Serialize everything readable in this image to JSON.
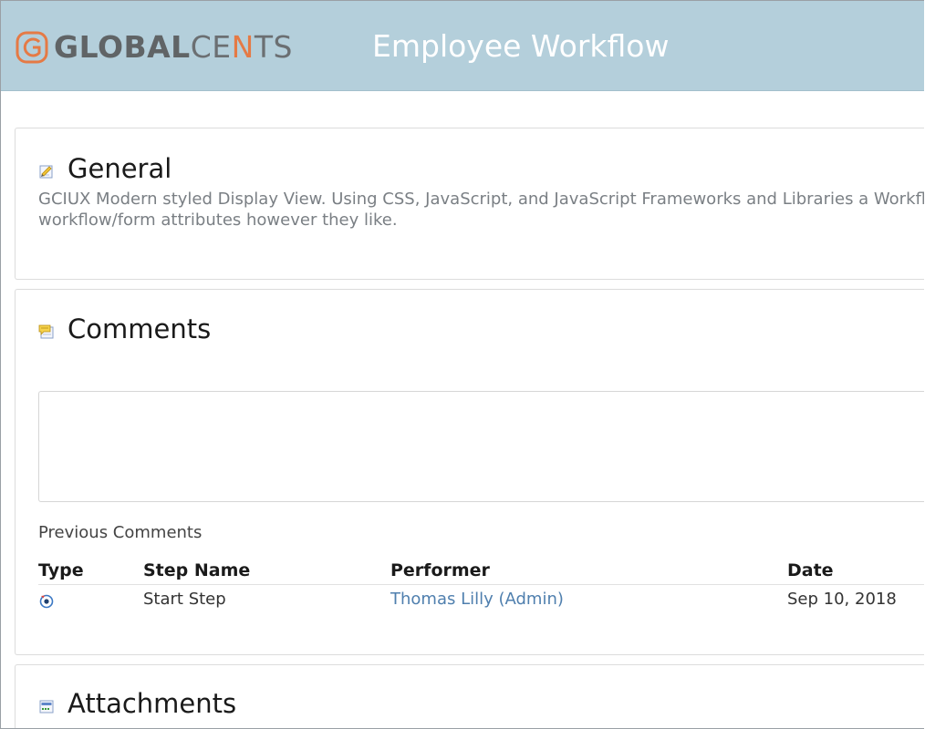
{
  "header": {
    "brand_bold": "GLOBAL",
    "brand_light": "CE",
    "brand_accent": "N",
    "brand_end": "TS",
    "title": "Employee Workflow"
  },
  "sections": {
    "general": {
      "icon": "pencil-document-icon",
      "title": "General",
      "description": "GCIUX Modern styled Display View. Using CSS, JavaScript, and JavaScript Frameworks and Libraries a Workflow workflow/form attributes however they like."
    },
    "comments": {
      "icon": "comment-document-icon",
      "title": "Comments",
      "comment_input_value": "",
      "previous_label": "Previous Comments",
      "columns": [
        "Type",
        "Step Name",
        "Performer",
        "Date"
      ],
      "rows": [
        {
          "type_icon": "start-step-icon",
          "step_name": "Start Step",
          "performer": "Thomas Lilly (Admin)",
          "date": "Sep 10, 2018"
        }
      ]
    },
    "attachments": {
      "icon": "attachment-document-icon",
      "title": "Attachments"
    }
  },
  "colors": {
    "header_bg": "#b4cfdb",
    "brand_accent": "#e57a45",
    "link": "#4f7fae"
  }
}
